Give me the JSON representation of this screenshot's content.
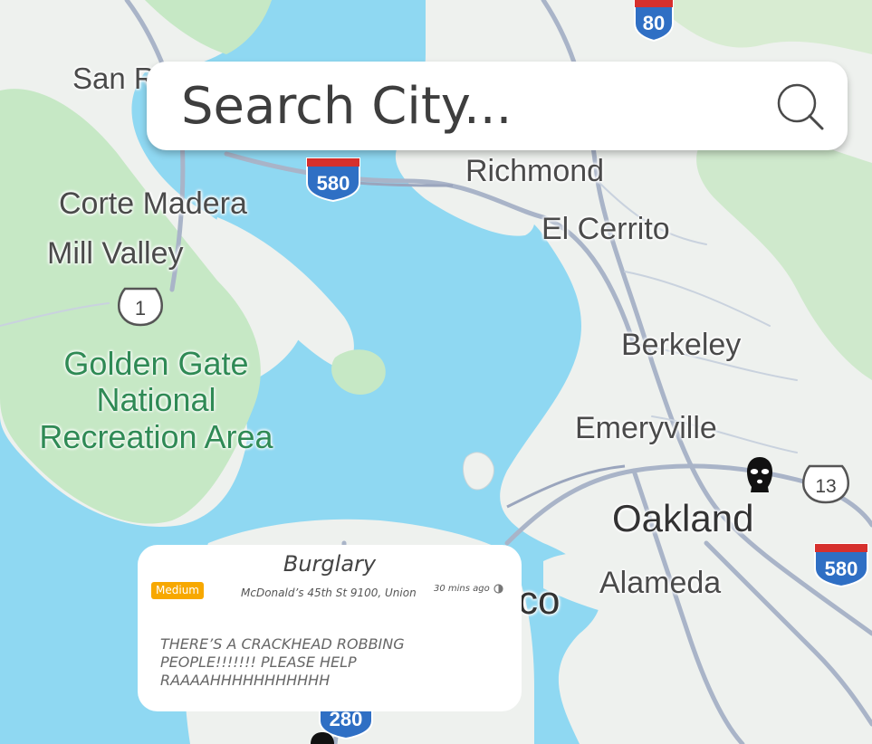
{
  "search": {
    "placeholder": "Search City..."
  },
  "map": {
    "labels": {
      "san_rafael": "San R",
      "richmond": "Richmond",
      "corte_madera": "Corte Madera",
      "el_cerrito": "El Cerrito",
      "mill_valley": "Mill Valley",
      "berkeley": "Berkeley",
      "emeryville": "Emeryville",
      "oakland": "Oakland",
      "alameda": "Alameda",
      "sf_partial": "co",
      "park": "Golden Gate National Recreation Area"
    },
    "highways": {
      "i80": "80",
      "i580_north": "580",
      "i580_east": "580",
      "i280": "280",
      "ca1": "1",
      "ca13": "13"
    }
  },
  "incident": {
    "type": "Burglary",
    "severity": "Medium",
    "location": "McDonald’s 45th St 9100, Union",
    "time": "30 mins ago",
    "description": "THERE’S A CRACKHEAD ROBBING PEOPLE!!!!!!! PLEASE HELP RAAAAHHHHHHHHHHH"
  },
  "markers": [
    {
      "icon": "burglar-mask-icon",
      "area": "Oakland"
    },
    {
      "icon": "incident-pin-icon",
      "area": "San Francisco"
    }
  ],
  "colors": {
    "water": "#8fd8f2",
    "land": "#eef1ee",
    "park": "#c6e8c5",
    "severity_medium": "#f7a800",
    "interstate_blue": "#2f6fc4",
    "interstate_red": "#d6302d"
  }
}
